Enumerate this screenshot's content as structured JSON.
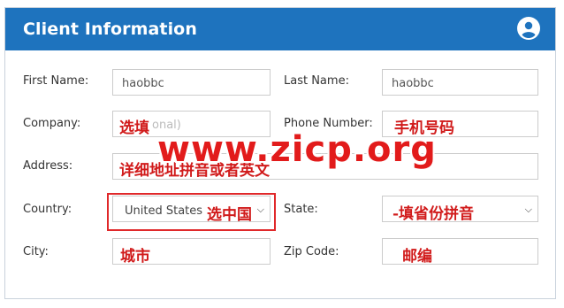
{
  "header": {
    "title": "Client Information",
    "avatar_icon": "user-circle-icon"
  },
  "form": {
    "first_name": {
      "label": "First Name:",
      "value": "haobbc"
    },
    "last_name": {
      "label": "Last Name:",
      "value": "haobbc"
    },
    "company": {
      "label": "Company:",
      "placeholder_visible": "onal)",
      "note": "选填"
    },
    "phone": {
      "label": "Phone Number:",
      "note": "手机号码"
    },
    "address": {
      "label": "Address:",
      "note": "详细地址拼音或者英文"
    },
    "country": {
      "label": "Country:",
      "value": "United States",
      "note": "选中国"
    },
    "state": {
      "label": "State:",
      "note": "-填省份拼音"
    },
    "city": {
      "label": "City:",
      "note": "城市"
    },
    "zip": {
      "label": "Zip Code:",
      "note": "邮编"
    }
  },
  "watermark": "www.zicp.org",
  "colors": {
    "header": "#1e73be",
    "annotation": "#d11b1b"
  }
}
